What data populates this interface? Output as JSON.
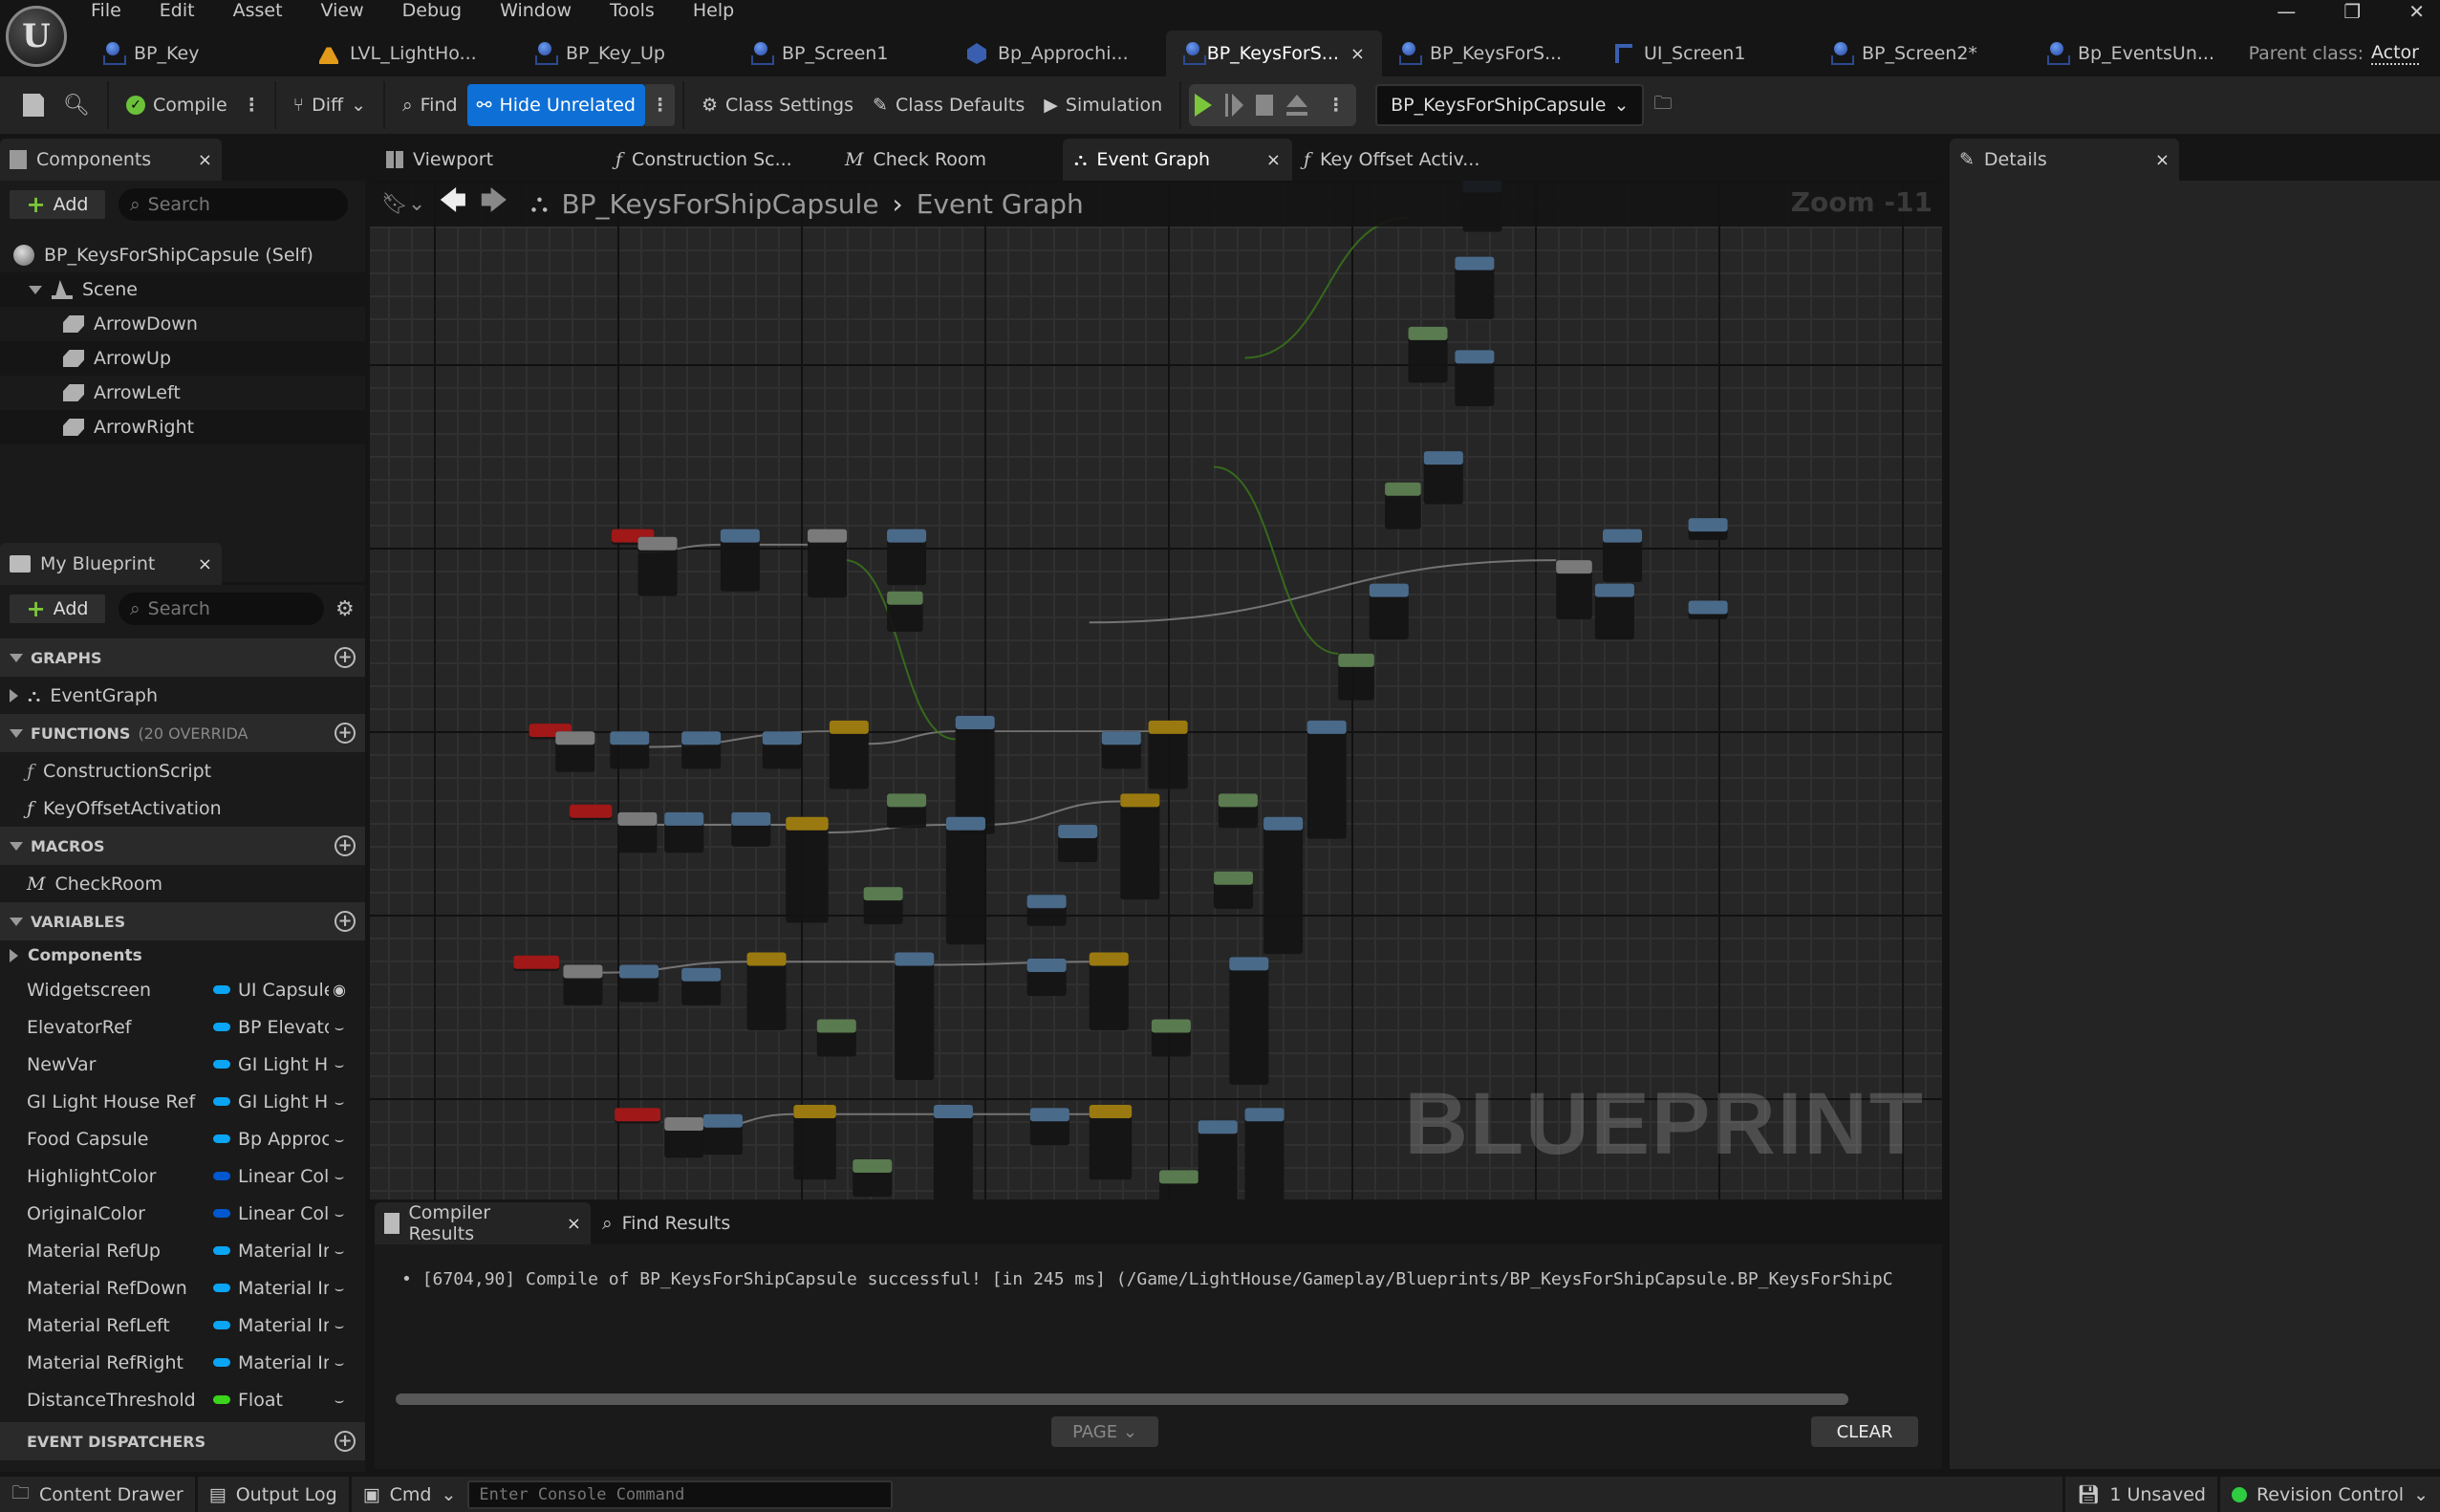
{
  "menu": [
    "File",
    "Edit",
    "Asset",
    "View",
    "Debug",
    "Window",
    "Tools",
    "Help"
  ],
  "doc_tabs": [
    {
      "label": "BP_Key",
      "icon": "blueprint-icon",
      "active": false
    },
    {
      "label": "LVL_LightHo...",
      "icon": "level-icon",
      "active": false
    },
    {
      "label": "BP_Key_Up",
      "icon": "blueprint-icon",
      "active": false
    },
    {
      "label": "BP_Screen1",
      "icon": "blueprint-icon",
      "active": false
    },
    {
      "label": "Bp_Approchi...",
      "icon": "cube-icon",
      "active": false
    },
    {
      "label": "BP_KeysForS...",
      "icon": "blueprint-icon",
      "active": true
    },
    {
      "label": "BP_KeysForS...",
      "icon": "blueprint-icon",
      "active": false
    },
    {
      "label": "UI_Screen1",
      "icon": "widget-icon",
      "active": false
    },
    {
      "label": "BP_Screen2*",
      "icon": "blueprint-icon",
      "active": false
    },
    {
      "label": "Bp_EventsUn...",
      "icon": "blueprint-icon",
      "active": false
    }
  ],
  "parent_class": {
    "label": "Parent class:",
    "value": "Actor"
  },
  "toolbar": {
    "compile": "Compile",
    "diff": "Diff",
    "find": "Find",
    "hide_unrelated": "Hide Unrelated",
    "class_settings": "Class Settings",
    "class_defaults": "Class Defaults",
    "simulation": "Simulation",
    "debug_object": "BP_KeysForShipCapsule"
  },
  "components": {
    "title": "Components",
    "add": "Add",
    "search_placeholder": "Search",
    "tree": [
      {
        "label": "BP_KeysForShipCapsule (Self)",
        "depth": 0,
        "icon": "actor-icon"
      },
      {
        "label": "Scene",
        "depth": 1,
        "icon": "scene-icon"
      },
      {
        "label": "ArrowDown",
        "depth": 2,
        "icon": "static-mesh-icon"
      },
      {
        "label": "ArrowUp",
        "depth": 2,
        "icon": "static-mesh-icon"
      },
      {
        "label": "ArrowLeft",
        "depth": 2,
        "icon": "static-mesh-icon"
      },
      {
        "label": "ArrowRight",
        "depth": 2,
        "icon": "static-mesh-icon"
      }
    ]
  },
  "my_blueprint": {
    "title": "My Blueprint",
    "add": "Add",
    "search_placeholder": "Search",
    "graphs_header": "GRAPHS",
    "graphs": [
      "EventGraph"
    ],
    "functions_header": "FUNCTIONS",
    "functions_sub": "(20 OVERRIDA",
    "functions": [
      "ConstructionScript",
      "KeyOffsetActivation"
    ],
    "macros_header": "MACROS",
    "macros": [
      "CheckRoom"
    ],
    "variables_header": "VARIABLES",
    "variables_group": "Components",
    "variables": [
      {
        "name": "Widgetscreen",
        "type": "UI Capsule",
        "color": "#0aa5f5",
        "visible": true
      },
      {
        "name": "ElevatorRef",
        "type": "BP Elevator",
        "color": "#0aa5f5",
        "visible": false
      },
      {
        "name": "NewVar",
        "type": "GI Light H",
        "color": "#0aa5f5",
        "visible": false
      },
      {
        "name": "GI Light House Ref",
        "type": "GI Light H",
        "color": "#0aa5f5",
        "visible": false
      },
      {
        "name": "Food Capsule",
        "type": "Bp Approc",
        "color": "#0aa5f5",
        "visible": false
      },
      {
        "name": "HighlightColor",
        "type": "Linear Col",
        "color": "#0058d0",
        "visible": false
      },
      {
        "name": "OriginalColor",
        "type": "Linear Col",
        "color": "#0058d0",
        "visible": false
      },
      {
        "name": "Material RefUp",
        "type": "Material In",
        "color": "#0aa5f5",
        "visible": false
      },
      {
        "name": "Material RefDown",
        "type": "Material In",
        "color": "#0aa5f5",
        "visible": false
      },
      {
        "name": "Material RefLeft",
        "type": "Material In",
        "color": "#0aa5f5",
        "visible": false
      },
      {
        "name": "Material RefRight",
        "type": "Material In",
        "color": "#0aa5f5",
        "visible": false
      },
      {
        "name": "DistanceThreshold",
        "type": "Float",
        "color": "#3ad41a",
        "visible": false
      }
    ],
    "dispatchers_header": "EVENT DISPATCHERS"
  },
  "graph_tabs": [
    {
      "label": "Viewport",
      "icon": "viewport-icon",
      "active": false
    },
    {
      "label": "Construction Sc...",
      "icon": "function-icon",
      "active": false
    },
    {
      "label": "Check Room",
      "icon": "macro-icon",
      "active": false
    },
    {
      "label": "Event Graph",
      "icon": "event-graph-icon",
      "active": true
    },
    {
      "label": "Key Offset Activ...",
      "icon": "function-icon",
      "active": false
    }
  ],
  "graph": {
    "breadcrumb_root": "BP_KeysForShipCapsule",
    "breadcrumb_current": "Event Graph",
    "zoom": "Zoom -11",
    "watermark": "BLUEPRINT"
  },
  "results": {
    "tabs": [
      "Compiler Results",
      "Find Results"
    ],
    "log": "[6704,90] Compile of BP_KeysForShipCapsule successful! [in 245 ms] (/Game/LightHouse/Gameplay/Blueprints/BP_KeysForShipCapsule.BP_KeysForShipC",
    "page": "PAGE",
    "clear": "CLEAR"
  },
  "details": {
    "title": "Details"
  },
  "statusbar": {
    "content_drawer": "Content Drawer",
    "output_log": "Output Log",
    "cmd": "Cmd",
    "console_placeholder": "Enter Console Command",
    "unsaved": "1 Unsaved",
    "revision_control": "Revision Control"
  },
  "colors": {
    "accent": "#0e6fd6",
    "play": "#7cc63b",
    "node_event": "#a01818",
    "node_function": "#4a6a8a",
    "node_pure": "#5a7a50",
    "node_timeline": "#9a7a10",
    "wire_exec": "#888888",
    "wire_object": "#1a6aa0",
    "wire_float": "#3a7a1a"
  }
}
